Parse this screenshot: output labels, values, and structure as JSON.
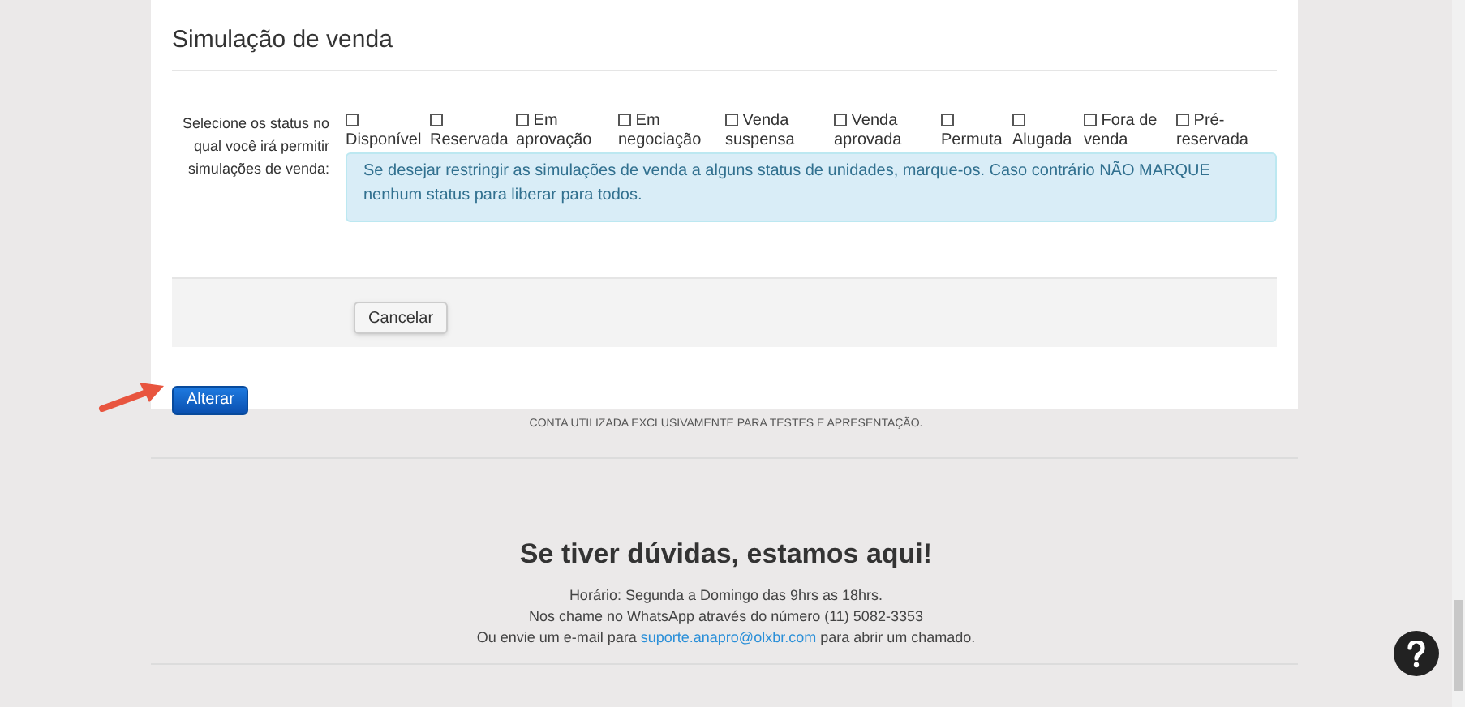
{
  "section_title": "Simulação de venda",
  "status_field": {
    "label": "Selecione os status no qual você irá permitir simulações de venda:",
    "options": [
      {
        "label": "Disponível",
        "checked": false
      },
      {
        "label": "Reservada",
        "checked": false
      },
      {
        "label": "Em aprovação",
        "checked": false
      },
      {
        "label": "Em negociação",
        "checked": false
      },
      {
        "label": "Venda suspensa",
        "checked": false
      },
      {
        "label": "Venda aprovada",
        "checked": false
      },
      {
        "label": "Permuta",
        "checked": false
      },
      {
        "label": "Alugada",
        "checked": false
      },
      {
        "label": "Fora de venda",
        "checked": false
      },
      {
        "label": "Pré-reservada",
        "checked": false
      }
    ],
    "help": "Se desejar restringir as simulações de venda a alguns status de unidades, marque-os. Caso contrário NÃO MARQUE nenhum status para liberar para todos."
  },
  "cancel_button": "Cancelar",
  "submit_button": "Alterar",
  "notice": "CONTA UTILIZADA EXCLUSIVAMENTE PARA TESTES E APRESENTAÇÃO.",
  "footer": {
    "heading": "Se tiver dúvidas, estamos aqui!",
    "lines": [
      "Horário: Segunda a Domingo das 9hrs as 18hrs.",
      "Nos chame no WhatsApp através do número (11) 5082-3353"
    ],
    "email_line": {
      "before": "Ou envie um e-mail para",
      "link": "suporte.anapro@olxbr.com",
      "after": "para abrir um chamado."
    }
  }
}
